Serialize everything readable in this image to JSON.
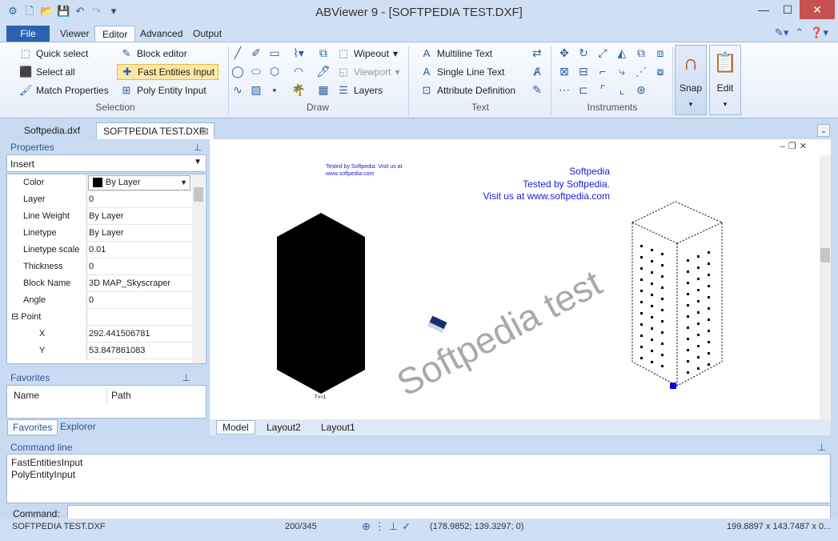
{
  "window": {
    "title": "ABViewer 9 - [SOFTPEDIA TEST.DXF]"
  },
  "menu_tabs": [
    "File",
    "Viewer",
    "Editor",
    "Advanced",
    "Output"
  ],
  "ribbon": {
    "selection": {
      "label": "Selection",
      "quick_select": "Quick select",
      "select_all": "Select all",
      "match_properties": "Match Properties",
      "block_editor": "Block editor",
      "fast_entities_input": "Fast Entities Input",
      "poly_entity_input": "Poly Entity Input"
    },
    "draw": {
      "label": "Draw",
      "wipeout": "Wipeout",
      "viewport": "Viewport",
      "layers": "Layers"
    },
    "text": {
      "label": "Text",
      "multiline_text": "Multiline Text",
      "single_line_text": "Single Line Text",
      "attribute_definition": "Attribute Definition"
    },
    "instruments": {
      "label": "Instruments"
    },
    "snap": "Snap",
    "edit": "Edit"
  },
  "doc_tabs": [
    "Softpedia.dxf",
    "SOFTPEDIA TEST.DXF"
  ],
  "properties": {
    "title": "Properties",
    "object_type": "Insert",
    "rows": [
      {
        "name": "Color",
        "value": "By Layer"
      },
      {
        "name": "Layer",
        "value": "0"
      },
      {
        "name": "Line Weight",
        "value": "By Layer"
      },
      {
        "name": "Linetype",
        "value": "By Layer"
      },
      {
        "name": "Linetype scale",
        "value": "0.01"
      },
      {
        "name": "Thickness",
        "value": "0"
      },
      {
        "name": "Block Name",
        "value": "3D MAP_Skyscraper"
      },
      {
        "name": "Angle",
        "value": "0"
      },
      {
        "name": "Point",
        "value": ""
      },
      {
        "name": "X",
        "value": "292.441506781"
      },
      {
        "name": "Y",
        "value": "53.847861083"
      }
    ]
  },
  "favorites": {
    "title": "Favorites",
    "col_name": "Name",
    "col_path": "Path",
    "tab_favorites": "Favorites",
    "tab_explorer": "Explorer"
  },
  "drawing": {
    "small_text_1": "Tested by Softpedia. Visit us at",
    "small_text_2": "www.softpedia.com",
    "line1": "Softpedia",
    "line2": "Tested by Softpedia.",
    "line3": "Visit us at www.softpedia.com",
    "watermark": "Softpedia test",
    "label_under": "T>>1"
  },
  "layout_tabs": [
    "Model",
    "Layout2",
    "Layout1"
  ],
  "command_line": {
    "title": "Command line",
    "history": [
      "FastEntitiesInput",
      "PolyEntityInput"
    ],
    "prompt": "Command:"
  },
  "status": {
    "file": "SOFTPEDIA TEST.DXF",
    "entities": "200/345",
    "coords": "(178.9852; 139.3297; 0)",
    "size": "199.8897 x 143.7487 x 0..."
  }
}
